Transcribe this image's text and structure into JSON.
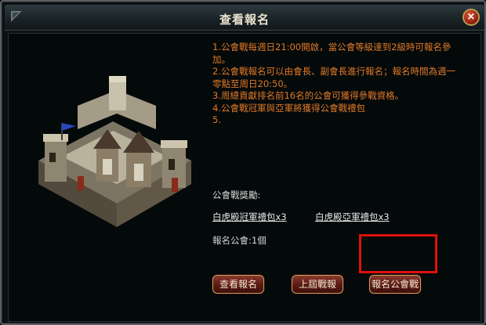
{
  "window": {
    "title": "查看報名",
    "close_label": "×"
  },
  "rules": [
    "1.公會戰每週日21:00開啟，當公會等級達到2級時可報名參加。",
    "2.公會戰報名可以由會長、副會長進行報名；報名時間為週一零點至周日20:50。",
    "3.周總貢獻排名前16名的公會可獲得參戰資格。",
    "4.公會戰冠軍與亞軍將獲得公會戰禮包",
    "5."
  ],
  "rewards": {
    "label": "公會戰獎勵:",
    "items": [
      "白虎殿冠軍禮包x3",
      "白虎殿亞軍禮包x3"
    ]
  },
  "registered": {
    "text": "報名公會:1個"
  },
  "buttons": {
    "view": "查看報名",
    "last": "上屆戰報",
    "register": "報名公會戰"
  },
  "colors": {
    "rules_text": "#e07a28",
    "highlight": "#e0100b"
  }
}
